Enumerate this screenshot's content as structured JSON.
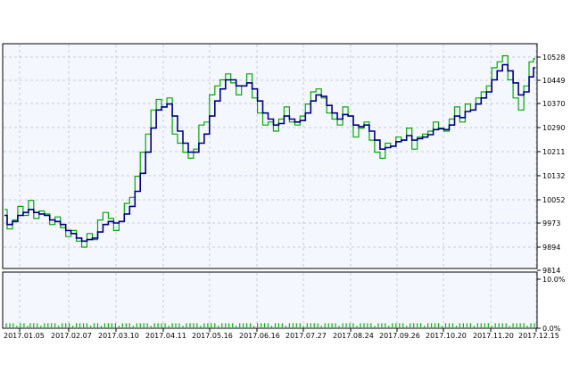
{
  "colors": {
    "background": "#ffffff",
    "plot_bg": "#f5f7ff",
    "grid": "#c8ccd8",
    "axis": "#000000",
    "line_main": "#00aa00",
    "line_signal": "#000080",
    "volume": "#00bb00"
  },
  "chart_data": [
    {
      "type": "line",
      "ylim": [
        9814,
        10560
      ],
      "yticks": [
        "10528",
        "10449",
        "10370",
        "10290",
        "10211",
        "10132",
        "10052",
        "9973",
        "9894",
        "9814"
      ],
      "xticks": [
        "2017.01.05",
        "2017.02.07",
        "2017.03.10",
        "2017.04.11",
        "2017.05.16",
        "2017.06.16",
        "2017.07.27",
        "2017.08.24",
        "2017.09.26",
        "2017.10.20",
        "2017.11.20",
        "2017.12.15"
      ],
      "series": [
        {
          "x": [
            0,
            6,
            12,
            18,
            24,
            30,
            36,
            42,
            48,
            54,
            60,
            66,
            72,
            78,
            84,
            90,
            96,
            102,
            108,
            114,
            120,
            126,
            132,
            138,
            144,
            150,
            156,
            162,
            168,
            174,
            180,
            186,
            192,
            198,
            204,
            210,
            216,
            222,
            228,
            234,
            240,
            246,
            252,
            258,
            264,
            270,
            276,
            282,
            288,
            294,
            300,
            306,
            312,
            318,
            324,
            330,
            336,
            342,
            348,
            354,
            360,
            366,
            372,
            378,
            384,
            390,
            396,
            402,
            408,
            414,
            420,
            426,
            432,
            438,
            444,
            450,
            456,
            462,
            468,
            474,
            480,
            486,
            492,
            498,
            504,
            510,
            516,
            522,
            528,
            534,
            540,
            546,
            552,
            558,
            564,
            570,
            576,
            582,
            588,
            594,
            598
          ],
          "values": [
            10010,
            9945,
            9975,
            10020,
            9990,
            10040,
            9980,
            10005,
            9995,
            9960,
            9985,
            9950,
            9920,
            9940,
            9905,
            9885,
            9930,
            9910,
            9975,
            10000,
            9980,
            9940,
            9970,
            10030,
            10050,
            10120,
            10200,
            10260,
            10340,
            10375,
            10350,
            10380,
            10260,
            10230,
            10200,
            10180,
            10210,
            10290,
            10300,
            10390,
            10420,
            10440,
            10460,
            10430,
            10390,
            10420,
            10460,
            10380,
            10330,
            10290,
            10300,
            10270,
            10310,
            10350,
            10300,
            10290,
            10320,
            10360,
            10400,
            10410,
            10380,
            10330,
            10310,
            10290,
            10350,
            10320,
            10250,
            10280,
            10300,
            10240,
            10200,
            10180,
            10230,
            10220,
            10250,
            10240,
            10280,
            10210,
            10250,
            10260,
            10270,
            10300,
            10280,
            10270,
            10310,
            10350,
            10300,
            10360,
            10340,
            10380,
            10400,
            10420,
            10480,
            10500,
            10520,
            10440,
            10380,
            10340,
            10420,
            10500,
            10510
          ]
        },
        {
          "x": [
            0,
            6,
            12,
            18,
            24,
            30,
            36,
            42,
            48,
            54,
            60,
            66,
            72,
            78,
            84,
            90,
            96,
            102,
            108,
            114,
            120,
            126,
            132,
            138,
            144,
            150,
            156,
            162,
            168,
            174,
            180,
            186,
            192,
            198,
            204,
            210,
            216,
            222,
            228,
            234,
            240,
            246,
            252,
            258,
            264,
            270,
            276,
            282,
            288,
            294,
            300,
            306,
            312,
            318,
            324,
            330,
            336,
            342,
            348,
            354,
            360,
            366,
            372,
            378,
            384,
            390,
            396,
            402,
            408,
            414,
            420,
            426,
            432,
            438,
            444,
            450,
            456,
            462,
            468,
            474,
            480,
            486,
            492,
            498,
            504,
            510,
            516,
            522,
            528,
            534,
            540,
            546,
            552,
            558,
            564,
            570,
            576,
            582,
            588,
            594,
            598
          ],
          "values": [
            9990,
            9960,
            9970,
            9990,
            10000,
            10010,
            10000,
            9995,
            9990,
            9975,
            9970,
            9960,
            9940,
            9930,
            9915,
            9905,
            9910,
            9915,
            9935,
            9960,
            9970,
            9965,
            9970,
            9995,
            10020,
            10070,
            10130,
            10200,
            10280,
            10340,
            10350,
            10360,
            10320,
            10270,
            10230,
            10200,
            10200,
            10230,
            10260,
            10320,
            10370,
            10410,
            10440,
            10440,
            10420,
            10420,
            10430,
            10410,
            10370,
            10330,
            10310,
            10290,
            10295,
            10320,
            10310,
            10300,
            10305,
            10330,
            10370,
            10390,
            10385,
            10355,
            10330,
            10310,
            10325,
            10320,
            10290,
            10285,
            10290,
            10270,
            10240,
            10210,
            10215,
            10220,
            10235,
            10240,
            10255,
            10240,
            10245,
            10250,
            10258,
            10275,
            10278,
            10275,
            10290,
            10320,
            10315,
            10335,
            10340,
            10360,
            10380,
            10400,
            10440,
            10470,
            10490,
            10470,
            10430,
            10390,
            10400,
            10450,
            10480
          ]
        }
      ]
    },
    {
      "type": "bar",
      "ylim": [
        0,
        10
      ],
      "yticks": [
        "10.0%",
        "0.0%"
      ],
      "x": [
        2,
        6,
        10,
        14,
        18,
        22,
        26,
        29,
        33,
        37,
        41,
        45,
        49,
        53,
        57,
        61,
        65,
        69,
        73,
        77,
        81,
        85,
        89,
        93,
        97,
        101,
        105,
        109,
        113,
        117,
        121,
        125,
        129,
        133,
        137,
        141,
        145,
        149,
        153,
        157,
        161,
        165,
        169,
        173,
        177,
        181,
        185,
        189,
        193,
        197,
        201,
        205,
        209,
        213,
        217,
        221,
        225,
        229,
        233,
        237,
        241,
        245,
        249,
        253,
        257,
        261,
        265,
        269,
        273,
        277,
        281,
        285,
        289,
        293,
        297,
        301,
        305,
        309,
        313,
        317,
        321,
        325,
        329,
        333,
        337,
        341,
        345,
        349,
        353,
        357,
        361,
        365,
        369,
        373,
        377,
        381,
        385,
        389,
        393,
        397,
        401,
        405,
        409,
        413,
        417,
        421,
        425,
        429,
        433,
        437,
        441,
        445,
        449,
        453,
        457,
        461,
        465,
        469,
        473,
        477,
        481,
        485,
        489,
        493,
        497,
        501,
        505,
        509,
        513,
        517,
        521,
        525,
        529,
        533,
        537,
        541,
        545,
        549,
        553,
        557,
        561,
        565,
        569,
        573,
        577,
        581,
        585,
        589,
        593,
        597
      ],
      "values": [
        2,
        2,
        2,
        1,
        2,
        2,
        1,
        2,
        2,
        2,
        1,
        2,
        2,
        2,
        2,
        1,
        2,
        2,
        2,
        1,
        2,
        2,
        2,
        2,
        1,
        2,
        2,
        1,
        2,
        2,
        2,
        2,
        1,
        2,
        2,
        2,
        1,
        2,
        2,
        2,
        2,
        1,
        2,
        2,
        2,
        2,
        1,
        2,
        2,
        2,
        1,
        2,
        2,
        2,
        2,
        1,
        2,
        2,
        2,
        2,
        1,
        2,
        2,
        2,
        2,
        1,
        2,
        2,
        2,
        2,
        1,
        2,
        2,
        2,
        2,
        1,
        2,
        2,
        2,
        1,
        2,
        2,
        2,
        2,
        1,
        2,
        2,
        2,
        2,
        1,
        2,
        2,
        2,
        2,
        1,
        2,
        2,
        2,
        2,
        1,
        2,
        2,
        2,
        2,
        1,
        2,
        2,
        2,
        1,
        2,
        2,
        2,
        2,
        1,
        2,
        2,
        2,
        2,
        1,
        2,
        2,
        2,
        2,
        1,
        2,
        2,
        2,
        1,
        2,
        2,
        2,
        2,
        1,
        2,
        2,
        2,
        2,
        1,
        2,
        2,
        2,
        2,
        1,
        2,
        2,
        2,
        2,
        1,
        2,
        2
      ]
    }
  ]
}
